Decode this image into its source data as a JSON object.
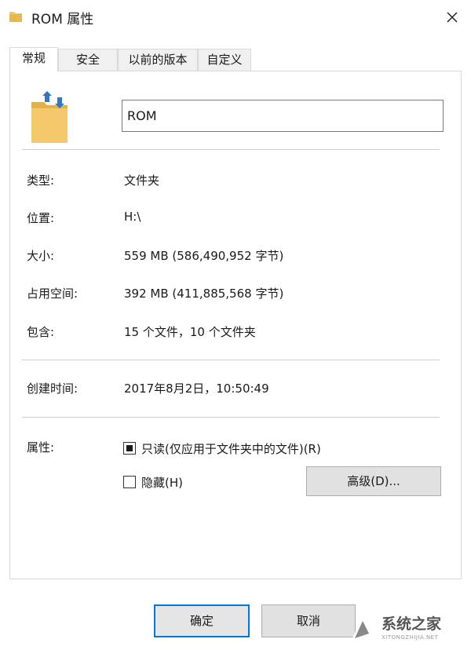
{
  "window": {
    "title": "ROM 属性"
  },
  "tabs": [
    {
      "label": "常规",
      "active": true
    },
    {
      "label": "安全",
      "active": false
    },
    {
      "label": "以前的版本",
      "active": false
    },
    {
      "label": "自定义",
      "active": false
    }
  ],
  "general": {
    "name_value": "ROM",
    "rows": {
      "type": {
        "label": "类型:",
        "value": "文件夹"
      },
      "location": {
        "label": "位置:",
        "value": "H:\\"
      },
      "size": {
        "label": "大小:",
        "value": "559 MB (586,490,952 字节)"
      },
      "size_on_disk": {
        "label": "占用空间:",
        "value": "392 MB (411,885,568 字节)"
      },
      "contains": {
        "label": "包含:",
        "value": "15 个文件，10 个文件夹"
      },
      "created": {
        "label": "创建时间:",
        "value": "2017年8月2日，10:50:49"
      }
    },
    "attributes": {
      "label": "属性:",
      "readonly": {
        "label": "只读(仅应用于文件夹中的文件)(R)",
        "state": "indeterminate"
      },
      "hidden": {
        "label": "隐藏(H)",
        "checked": false
      },
      "advanced_label": "高级(D)..."
    }
  },
  "footer": {
    "ok_label": "确定",
    "cancel_label": "取消"
  },
  "watermark": {
    "text": "系统之家",
    "sub": "XITONGZHIJIA.NET"
  },
  "colors": {
    "accent": "#0078d7",
    "folder": "#f5c96b",
    "folder_dark": "#e2b04d"
  }
}
